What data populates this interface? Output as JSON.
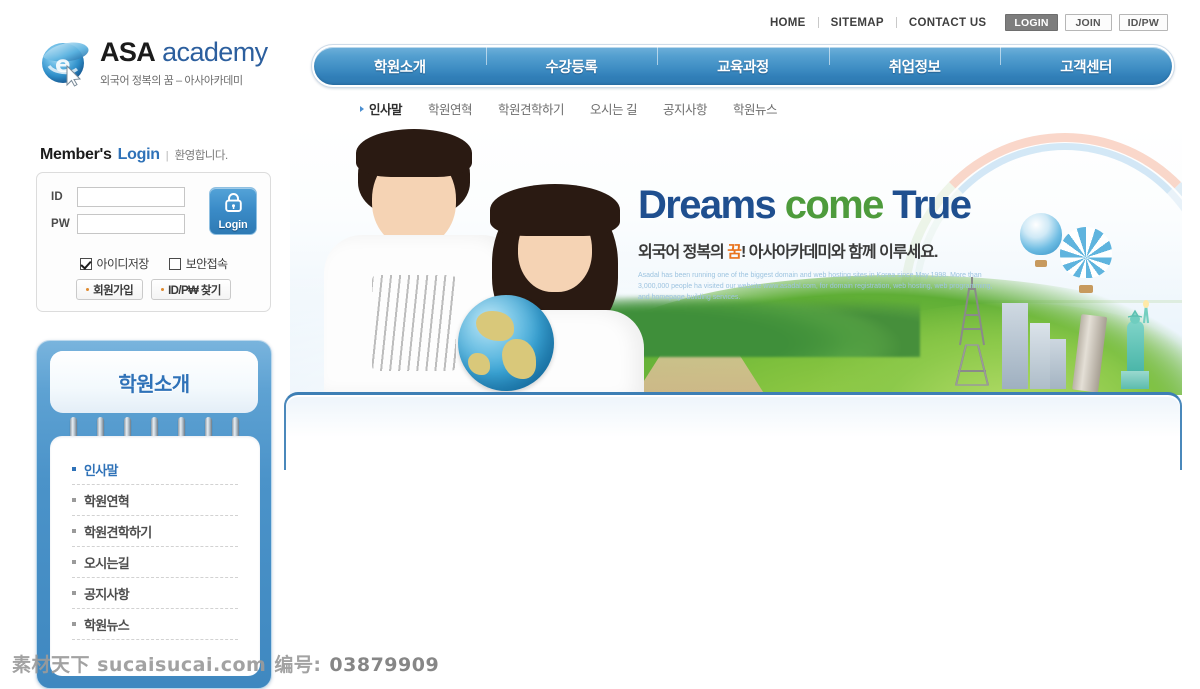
{
  "site": {
    "logo_title_primary": "ASA",
    "logo_title_secondary": "academy",
    "logo_tagline": "외국어 정복의 꿈 – 아사아카데미",
    "logo_icon": "ie-browser-e-icon"
  },
  "utility_nav": {
    "links": [
      {
        "label": "HOME",
        "name": "home"
      },
      {
        "label": "SITEMAP",
        "name": "sitemap"
      },
      {
        "label": "CONTACT US",
        "name": "contact-us"
      }
    ],
    "buttons": [
      {
        "label": "LOGIN",
        "name": "login",
        "active": true
      },
      {
        "label": "JOIN",
        "name": "join",
        "active": false
      },
      {
        "label": "ID/PW",
        "name": "id-pw",
        "active": false
      }
    ]
  },
  "main_nav": {
    "items": [
      {
        "label": "학원소개",
        "name": "academy-intro"
      },
      {
        "label": "수강등록",
        "name": "course-registration"
      },
      {
        "label": "교육과정",
        "name": "curriculum"
      },
      {
        "label": "취업정보",
        "name": "job-info"
      },
      {
        "label": "고객센터",
        "name": "customer-center"
      }
    ]
  },
  "sub_nav": {
    "items": [
      {
        "label": "인사말",
        "active": true
      },
      {
        "label": "학원연혁",
        "active": false
      },
      {
        "label": "학원견학하기",
        "active": false
      },
      {
        "label": "오시는 길",
        "active": false
      },
      {
        "label": "공지사항",
        "active": false
      },
      {
        "label": "학원뉴스",
        "active": false
      }
    ]
  },
  "login": {
    "heading_member": "Member's",
    "heading_login": "Login",
    "heading_separator": "|",
    "heading_welcome": "환영합니다.",
    "id_label": "ID",
    "pw_label": "PW",
    "id_value": "",
    "pw_value": "",
    "id_placeholder": "",
    "pw_placeholder": "",
    "submit_label": "Login",
    "submit_icon": "lock-icon",
    "checkboxes": [
      {
        "label": "아이디저장",
        "checked": true
      },
      {
        "label": "보안접속",
        "checked": false
      }
    ],
    "actions": [
      {
        "label": "회원가입"
      },
      {
        "label": "ID/P₩ 찾기"
      }
    ]
  },
  "side_menu": {
    "title": "학원소개",
    "ring_count": 7,
    "items": [
      {
        "label": "인사말",
        "active": true
      },
      {
        "label": "학원연혁",
        "active": false
      },
      {
        "label": "학원견학하기",
        "active": false
      },
      {
        "label": "오시는길",
        "active": false
      },
      {
        "label": "공지사항",
        "active": false
      },
      {
        "label": "학원뉴스",
        "active": false
      }
    ]
  },
  "banner": {
    "headline_word1": "Dreams",
    "headline_word2": "come",
    "headline_word3": "True",
    "subline_pre": "외국어 정복의 ",
    "subline_highlight": "꿈",
    "subline_post": "! 아사아카데미와 함께 이루세요.",
    "fineprint": "Asadal has been running one of the biggest domain and web hosting sites in Korea since May 1998. More than 3,000,000 people ha visited our website www.asadal.com, for domain registration, web hosting, web programming, and homepage building services.",
    "imagery": [
      "student-boy",
      "student-girl",
      "globe",
      "rainbow",
      "hot-air-balloon",
      "eiffel-tower",
      "leaning-tower-of-pisa",
      "statue-of-liberty",
      "city-skyline",
      "grass-field"
    ]
  },
  "watermark": {
    "site": "素材天下 sucaisucai.com",
    "id_label": "编号:",
    "id_value": "03879909"
  },
  "colors": {
    "accent_blue": "#2f72b8",
    "nav_blue": "#3f8ec4",
    "headline_blue": "#1f4f8f",
    "headline_green": "#4e9b3c",
    "highlight_orange": "#e9731d"
  }
}
